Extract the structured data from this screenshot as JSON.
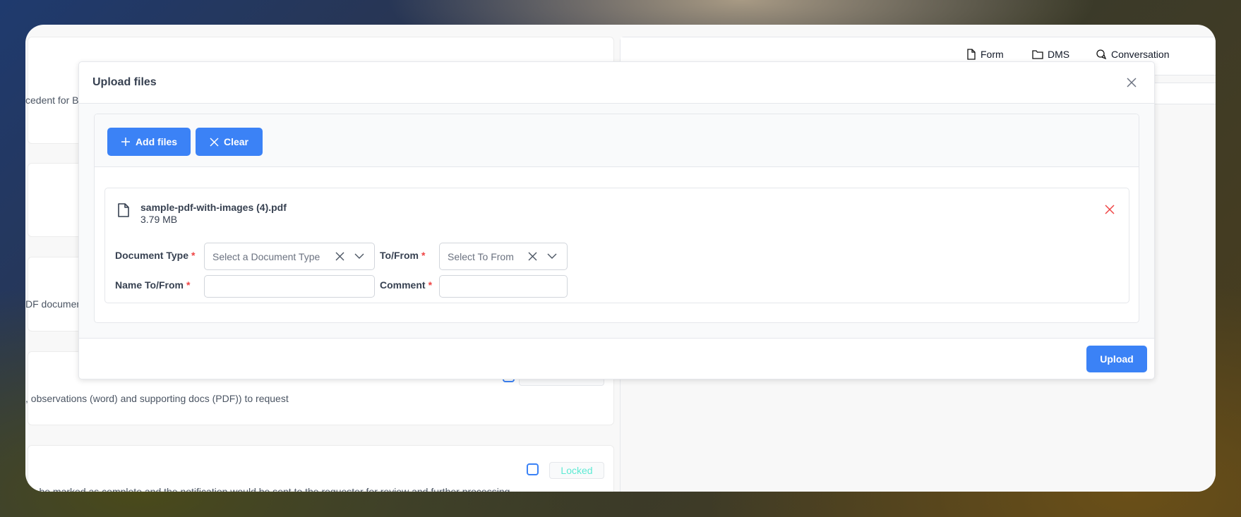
{
  "background": {
    "snippets": [
      "cedent for B",
      "DF documen",
      ", observations (word) and supporting docs (PDF)) to request",
      "an be marked as complete and the notification would be sent to the requester for review and further processing"
    ],
    "badges": [
      "",
      "Locked"
    ]
  },
  "tabs": [
    {
      "label": "Form",
      "icon": "file-icon"
    },
    {
      "label": "DMS",
      "icon": "folder-icon"
    },
    {
      "label": "Conversation",
      "icon": "chat-icon"
    }
  ],
  "modal": {
    "title": "Upload files",
    "add_files": "Add files",
    "clear": "Clear",
    "file": {
      "name": "sample-pdf-with-images (4).pdf",
      "size": "3.79 MB"
    },
    "fields": {
      "document_type": {
        "label": "Document Type",
        "placeholder": "Select a Document Type"
      },
      "to_from": {
        "label": "To/From",
        "placeholder": "Select To From"
      },
      "name_to_from": {
        "label": "Name To/From",
        "value": ""
      },
      "comment": {
        "label": "Comment",
        "value": ""
      },
      "required_mark": "*"
    },
    "upload": "Upload"
  },
  "colors": {
    "primary": "#3b82f6",
    "danger": "#ef4444",
    "locked": "#5eead4"
  }
}
